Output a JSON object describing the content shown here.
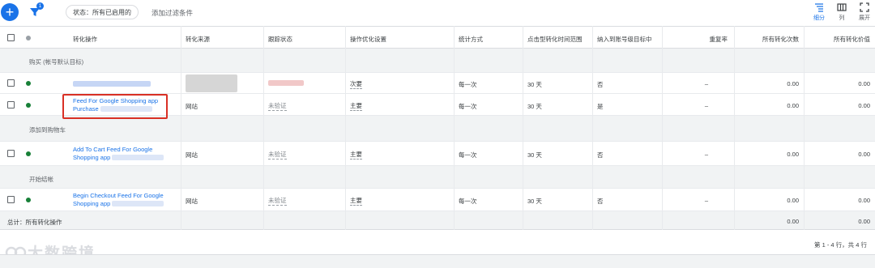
{
  "toolbar": {
    "add_icon": "plus-icon",
    "filter_icon": "filter-icon",
    "filter_count": "1",
    "status_chip": "状态：所有已启用的",
    "add_filter": "添加过滤条件",
    "views": [
      {
        "label": "细分",
        "icon": "segment-icon"
      },
      {
        "label": "列",
        "icon": "columns-icon"
      },
      {
        "label": "展开",
        "icon": "expand-icon"
      }
    ]
  },
  "columns": [
    "转化操作",
    "转化来源",
    "跟踪状态",
    "操作优化设置",
    "统计方式",
    "点击型转化时间范围",
    "纳入到账号级目标中",
    "重复率",
    "所有转化次数",
    "所有转化价值"
  ],
  "groups": [
    {
      "title": "购买 (帐号默认目标)",
      "rows": [
        {
          "name": "",
          "source": "",
          "status": "",
          "optimization": "次要",
          "counting": "每一次",
          "window": "30 天",
          "include": "否",
          "repeat": "–",
          "conversions": "0.00",
          "value": "0.00",
          "blurred": true
        },
        {
          "name_line1": "Feed For Google Shopping app",
          "name_line2": "Purchase",
          "source": "网站",
          "status": "未验证",
          "optimization": "主要",
          "counting": "每一次",
          "window": "30 天",
          "include": "是",
          "repeat": "–",
          "conversions": "0.00",
          "value": "0.00"
        }
      ]
    },
    {
      "title": "添加到购物车",
      "rows": [
        {
          "name_line1": "Add To Cart Feed For Google",
          "name_line2": "Shopping app",
          "source": "网站",
          "status": "未验证",
          "optimization": "主要",
          "counting": "每一次",
          "window": "30 天",
          "include": "否",
          "repeat": "–",
          "conversions": "0.00",
          "value": "0.00"
        }
      ]
    },
    {
      "title": "开始结帐",
      "rows": [
        {
          "name_line1": "Begin Checkout Feed For Google",
          "name_line2": "Shopping app",
          "source": "网站",
          "status": "未验证",
          "optimization": "主要",
          "counting": "每一次",
          "window": "30 天",
          "include": "否",
          "repeat": "–",
          "conversions": "0.00",
          "value": "0.00"
        }
      ]
    }
  ],
  "total": {
    "label": "总计：所有转化操作",
    "conversions": "0.00",
    "value": "0.00"
  },
  "pager": "第 1 - 4 行，共 4 行",
  "watermark": "大数跨境",
  "colors": {
    "accent": "#1a73e8",
    "status_green": "#188038",
    "highlight": "#d93025"
  }
}
